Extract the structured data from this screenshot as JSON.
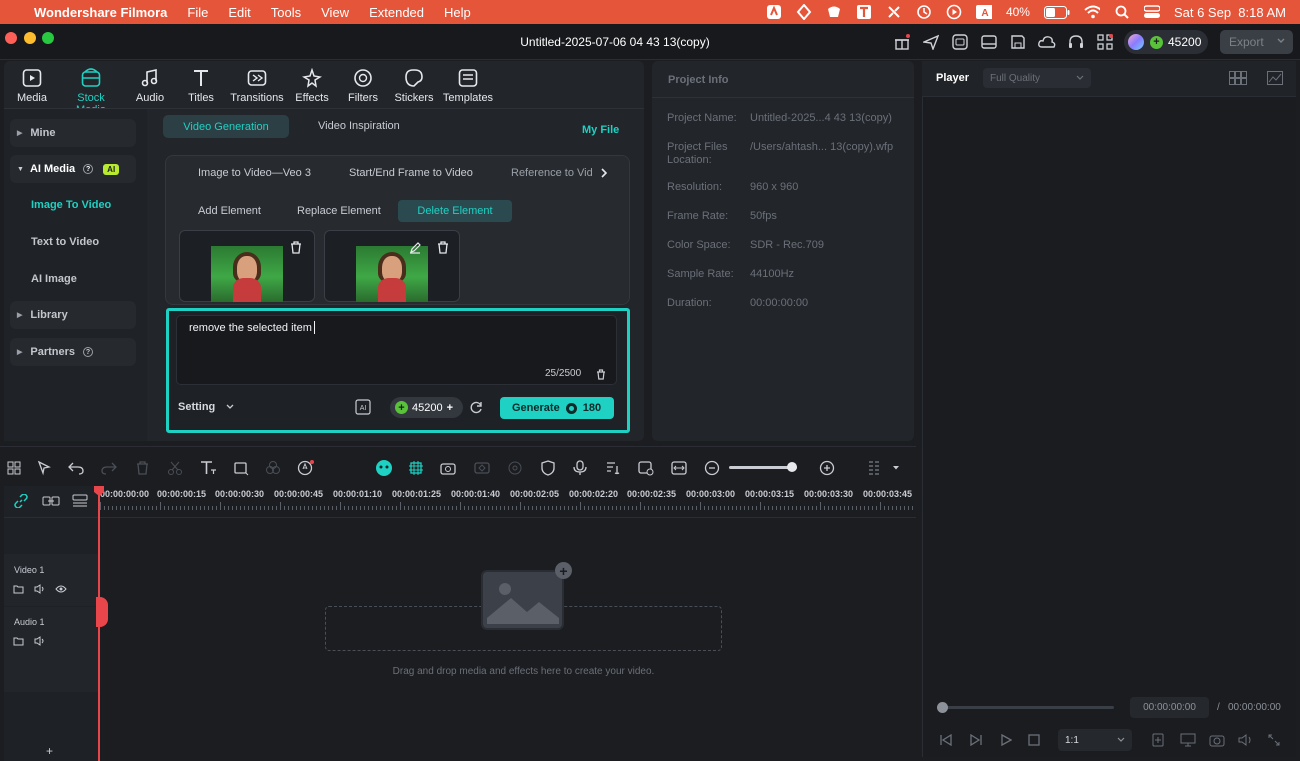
{
  "menubar": {
    "app_name": "Wondershare Filmora",
    "menus": [
      "File",
      "Edit",
      "Tools",
      "View",
      "Extended",
      "Help"
    ],
    "battery": "40%",
    "datetime": "Sat 6 Sep  8:18 AM"
  },
  "window": {
    "title": "Untitled-2025-07-06 04 43 13(copy)",
    "credits": "45200",
    "export_label": "Export"
  },
  "toolbar_tabs": [
    {
      "label": "Media",
      "icon": "media-icon"
    },
    {
      "label": "Stock Media",
      "icon": "stock-media-icon"
    },
    {
      "label": "Audio",
      "icon": "audio-icon"
    },
    {
      "label": "Titles",
      "icon": "titles-icon"
    },
    {
      "label": "Transitions",
      "icon": "transitions-icon"
    },
    {
      "label": "Effects",
      "icon": "effects-icon"
    },
    {
      "label": "Filters",
      "icon": "filters-icon"
    },
    {
      "label": "Stickers",
      "icon": "stickers-icon"
    },
    {
      "label": "Templates",
      "icon": "templates-icon"
    }
  ],
  "sidebar": {
    "mine": "Mine",
    "ai_media": "AI Media",
    "ai_badge": "AI",
    "image_to_video": "Image To Video",
    "text_to_video": "Text to Video",
    "ai_image": "AI Image",
    "library": "Library",
    "partners": "Partners"
  },
  "generation": {
    "tab_video_generation": "Video Generation",
    "tab_video_inspiration": "Video Inspiration",
    "my_file": "My File",
    "mode_tabs": [
      "Image to Video—Veo 3",
      "Start/End Frame to Video",
      "Reference to Vid"
    ],
    "element_tabs": [
      "Add Element",
      "Replace Element",
      "Delete Element"
    ],
    "prompt_text": "remove the selected item",
    "char_count": "25/2500",
    "setting_label": "Setting",
    "credits": "45200",
    "generate_label": "Generate",
    "generate_cost": "180"
  },
  "project_info": {
    "title": "Project Info",
    "rows": [
      {
        "label": "Project Name:",
        "value": "Untitled-2025...4 43 13(copy)"
      },
      {
        "label": "Project Files Location:",
        "value": "/Users/ahtash... 13(copy).wfp"
      },
      {
        "label": "Resolution:",
        "value": "960 x 960"
      },
      {
        "label": "Frame Rate:",
        "value": "50fps"
      },
      {
        "label": "Color Space:",
        "value": "SDR - Rec.709"
      },
      {
        "label": "Sample Rate:",
        "value": "44100Hz"
      },
      {
        "label": "Duration:",
        "value": "00:00:00:00"
      }
    ]
  },
  "player": {
    "label": "Player",
    "quality": "Full Quality",
    "current_time": "00:00:00:00",
    "separator": "/",
    "total_time": "00:00:00:00",
    "ratio": "1:1"
  },
  "timeline": {
    "ruler": [
      "00:00:00:00",
      "00:00:00:15",
      "00:00:00:30",
      "00:00:00:45",
      "00:00:01:10",
      "00:00:01:25",
      "00:00:01:40",
      "00:00:02:05",
      "00:00:02:20",
      "00:00:02:35",
      "00:00:03:00",
      "00:00:03:15",
      "00:00:03:30",
      "00:00:03:45"
    ],
    "video_track": "Video 1",
    "audio_track": "Audio 1",
    "drop_hint": "Drag and drop media and effects here to create your video."
  },
  "colors": {
    "accent": "#1fd1c3",
    "menubar": "#e4553a",
    "playhead": "#e8464a",
    "credit_green": "#59c23a"
  }
}
